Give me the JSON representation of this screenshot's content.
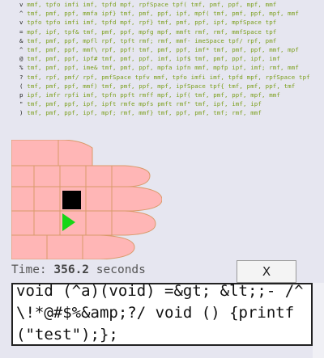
{
  "code_lines": [
    {
      "prefix": "v",
      "text": "mmf, tpfo imfi imf, tpfd mpf, rpfSpace tpf( tmf, pmf, ppf, mpf, mmf"
    },
    {
      "prefix": "^",
      "text": "tmf, pmf, ppf, mmfa ipf} tmf, pmf, ppf, ipf, mpf( tmf, pmf, ppf, mpf, mmf"
    },
    {
      "prefix": "v",
      "text": "tpfo tpfo imfi imf, tpfd mpf, rpf} tmf, pmf, ppf, ipf, mpfSpace tpf"
    },
    {
      "prefix": "=",
      "text": "mpf, ipf, tpf& tmf, pmf, ppf, mpfg mpf, mmft rmf, rmf, mmfSpace tpf"
    },
    {
      "prefix": "&",
      "text": "tmf, pmf, ppf, mpfl rpf, tpft rmf; rmf, mmf- imeSpace tpf/ rpf, pmf"
    },
    {
      "prefix": "^",
      "text": "tmf, pmf, ppf, mmf\\ rpf, ppf! tmf, pmf, ppf, imf* tmf, pmf, ppf, mmf, mpf"
    },
    {
      "prefix": "@",
      "text": "tmf, pmf, ppf, ipf# tmf, pmf, ppf, imf, ipf$ tmf, pmf, ppf, ipf, imf"
    },
    {
      "prefix": "%",
      "text": "tmf, pmf, ppf, ime& tmf, pmf, ppf, mpfa ipfn mmf, mpfp ipf, imf; rmf, mmf"
    },
    {
      "prefix": "?",
      "text": "tmf, rpf, pmf/ rpf, pmfSpace tpfv mmf, tpfo imfi imf, tpfd mpf, rpfSpace tpf"
    },
    {
      "prefix": "(",
      "text": "tmf, pmf, ppf, mmf) tmf, pmf, ppf, mpf, ipfSpace tpf{ tmf, pmf, ppf, tmf"
    },
    {
      "prefix": "p",
      "text": "ipf, imfr rpfi imf, tpfn ppft rmff mpf, ipf( tmf, pmf, ppf, mpf, mmf"
    },
    {
      "prefix": "\"",
      "text": "tmf, pmf, ppf, ipf, ipft rmfe mpfs pmft rmf\" tmf, ipf, imf, ipf"
    },
    {
      "prefix": ")",
      "text": "tmf, pmf, ppf, ipf, mpf; rmf, mmf} tmf, ppf, pmf, tmf; rmf, mmf"
    }
  ],
  "timer": {
    "label": "Time:",
    "value": "356.2",
    "unit": "seconds"
  },
  "close_button": {
    "label": "X"
  },
  "code_input": {
    "value": "void (^a)(void) =&gt; &lt;;- /^\\!*@#$%&amp;?/ void () {printf(\"test\");};"
  },
  "colors": {
    "background": "#e6e6f0",
    "hand": "#ffb6b6",
    "hand_outline": "#d99a6a",
    "block": "#000000",
    "play": "#16d616",
    "token": "#7a9e1a"
  },
  "icons": {
    "block_marker": "black-square-icon",
    "play_marker": "green-triangle-icon"
  }
}
